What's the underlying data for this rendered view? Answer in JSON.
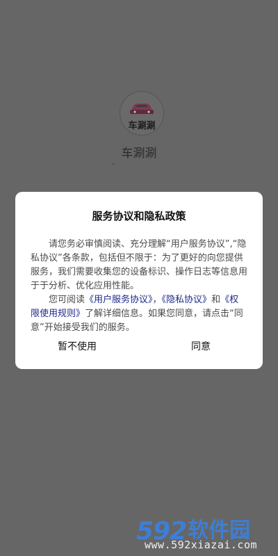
{
  "app": {
    "logo_text": "车涮涮",
    "name": "车涮涮"
  },
  "dialog": {
    "title": "服务协议和隐私政策",
    "para1": "请您务必审慎阅读、充分理解“用户服务协议”,“隐私协议”各条款，包括但不限于：为了更好的向您提供服务，我们需要收集您的设备标识、操作日志等信息用于于分析、优化应用性能。",
    "para2_prefix": "您可阅读",
    "link_user_agreement": "《用户服务协议》",
    "sep1": "，",
    "link_privacy": "《隐私协议》",
    "and": "和",
    "link_rules": "《权限使用规则》",
    "para2_suffix": "了解详细信息。如果您同意，请点击“同意”开始接受我们的服务。",
    "decline_label": "暂不使用",
    "agree_label": "同意"
  },
  "watermark": {
    "number": "592",
    "brand": "软件园",
    "url": "www.592xiazai.com"
  },
  "colors": {
    "overlay": "#666666",
    "dialog_bg": "#ffffff",
    "link": "#1e2a8a",
    "watermark": "#3d7fd6"
  },
  "icons": {
    "logo": "car-icon"
  }
}
